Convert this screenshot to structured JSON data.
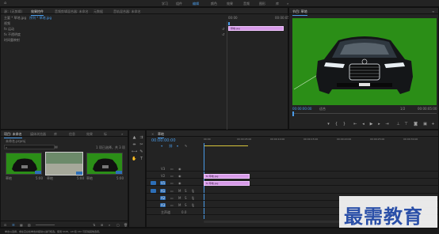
{
  "menu": {
    "items": [
      "学习",
      "组件",
      "编辑",
      "颜色",
      "效果",
      "音频",
      "图形",
      "库"
    ],
    "active_index": 2,
    "more": "»"
  },
  "effect_controls": {
    "tabs": [
      "源：(无剪辑)",
      "效果控件",
      "音频剪辑混合器: 未命名",
      "元数据",
      "音轨混合器: 未命名"
    ],
    "active_tab": 1,
    "source_label": "主要 * 草地.jpg",
    "clip_label": "序列 * 草地.jpg",
    "timecode_left": "00:00",
    "timecode_right": "00:00:05",
    "section": "视频",
    "effects": [
      "fx 运动",
      "fx 不透明度",
      "时间重映射"
    ],
    "clip_chip": "草地.jpg"
  },
  "program_monitor": {
    "title": "节目: 草地",
    "timecode": "00:00:00:00",
    "fit": "适合",
    "quality": "1/2",
    "duration": "00:00:05:00",
    "colors": {
      "background": "#2b8e17"
    }
  },
  "project": {
    "tabs": [
      "项目: 未命名",
      "媒体浏览器",
      "库",
      "信息",
      "效果",
      "标"
    ],
    "active_tab": 0,
    "file": "未命名.prproj",
    "selection": "1 项已选择，共 3 项",
    "clips": [
      {
        "name": "草地",
        "duration": "5:00"
      },
      {
        "name": "草地",
        "duration": "5:00"
      },
      {
        "name": "草地",
        "duration": "5:00"
      }
    ]
  },
  "timeline": {
    "title": "草地",
    "timecode": "00:00:00:00",
    "ruler_marks": [
      "00:00",
      "00:00:05:00",
      "00:00:10:00",
      "00:00:15:00",
      "00:00:20:00",
      "00:00:25:00",
      "00:00:30:00",
      "00:00:35:00"
    ],
    "video_tracks": [
      "V3",
      "V2",
      "V1"
    ],
    "audio_tracks": [
      "A1",
      "A2",
      "A3"
    ],
    "master": "主声道",
    "master_value": "0.0",
    "clips": [
      {
        "label": "fx 草地.jpg",
        "track": "V2"
      },
      {
        "label": "fx 草地.jpg",
        "track": "V1"
      }
    ]
  },
  "status": {
    "text": "单击以选择，或在空白处单击并拖动以进行框选。使用 Shift、Alt 和 Ctrl 可获得其他选项。"
  },
  "watermark": {
    "text": "最需教育"
  }
}
